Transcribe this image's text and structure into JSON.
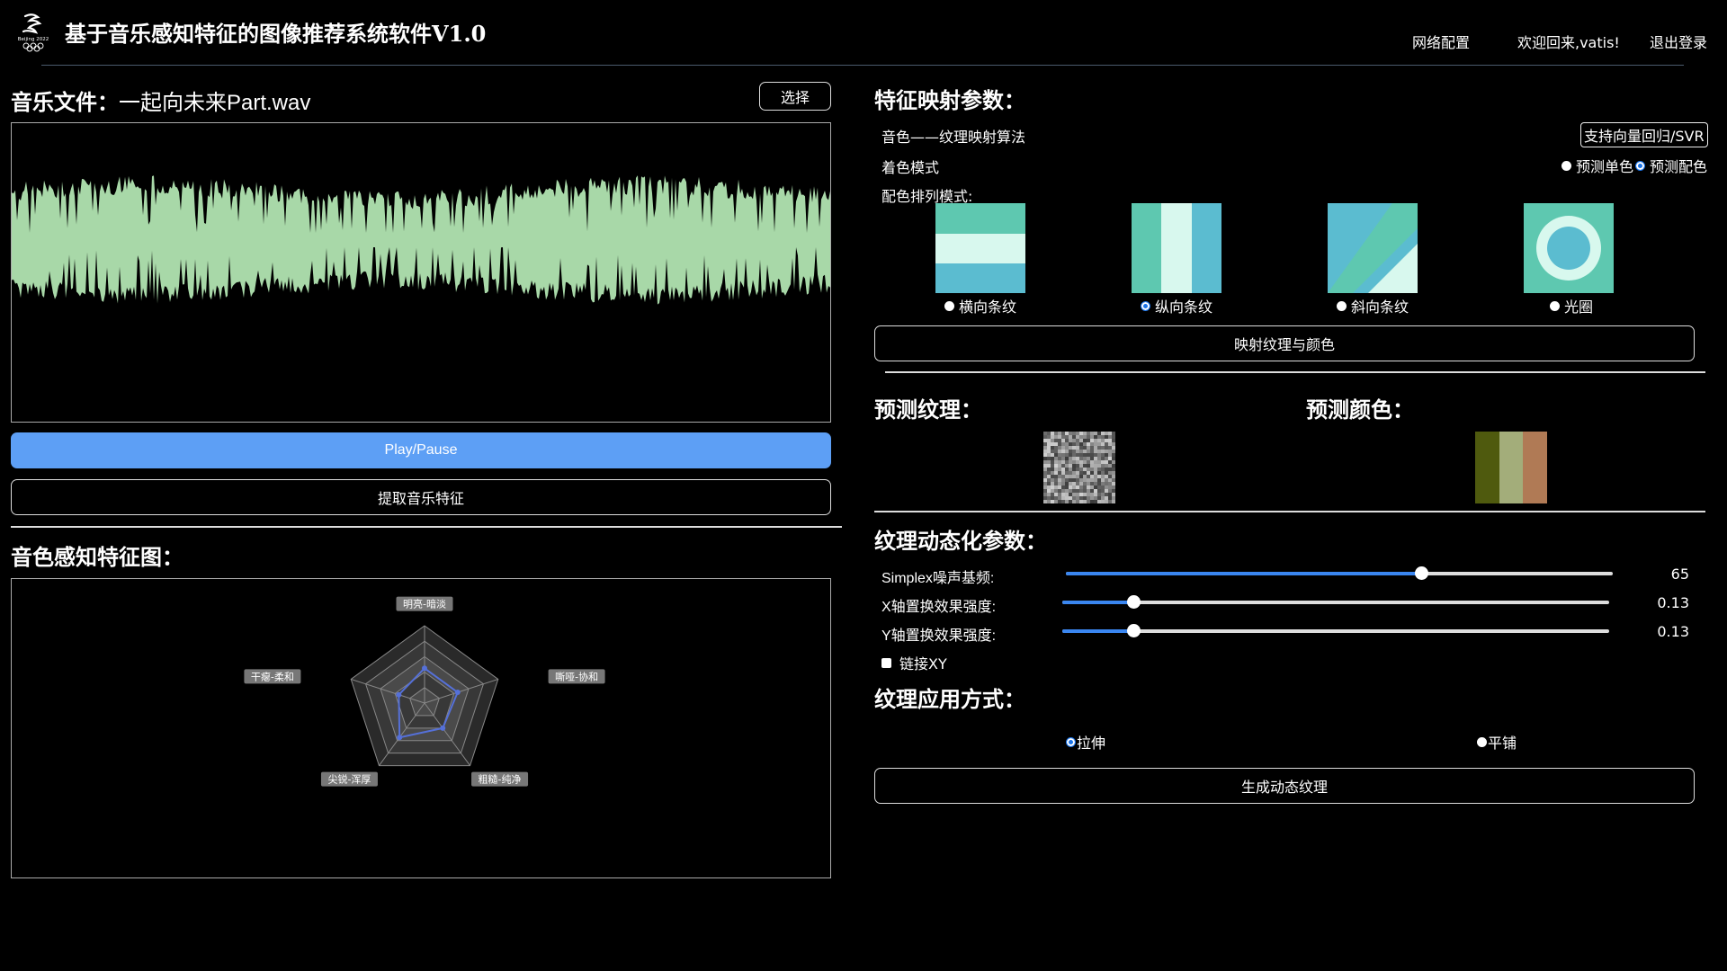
{
  "header": {
    "title": "基于音乐感知特征的图像推荐系统软件V1.0",
    "logo_text": "Beijing 2022",
    "nav": [
      "网络配置",
      "欢迎回来,vatis!",
      "退出登录"
    ]
  },
  "music": {
    "label": "音乐文件：",
    "file": "一起向未来Part.wav",
    "select_button": "选择",
    "play_button": "Play/Pause",
    "extract_button": "提取音乐特征",
    "waveform_color": "#a8d8a8"
  },
  "timbre": {
    "heading": "音色感知特征图：",
    "axes": [
      "明亮-暗淡",
      "嘶哑-协和",
      "粗糙-纯净",
      "尖锐-浑厚",
      "干瘪-柔和"
    ],
    "values": [
      0.45,
      0.45,
      0.4,
      0.55,
      0.35
    ],
    "series_color": "#5570d8"
  },
  "mapping": {
    "heading": "特征映射参数：",
    "algorithm_label": "音色——纹理映射算法",
    "algorithm_button": "支持向量回归/SVR",
    "color_mode_label": "着色模式",
    "color_modes": [
      {
        "label": "预测单色",
        "selected": false
      },
      {
        "label": "预测配色",
        "selected": true
      }
    ],
    "arrangement_label": "配色排列模式:",
    "arrangements": [
      {
        "label": "横向条纹",
        "selected": false
      },
      {
        "label": "纵向条纹",
        "selected": true
      },
      {
        "label": "斜向条纹",
        "selected": false
      },
      {
        "label": "光圈",
        "selected": false
      }
    ],
    "pattern_colors": [
      "#5ec8b0",
      "#5bbcd0",
      "#d8f8ee"
    ],
    "map_button": "映射纹理与颜色"
  },
  "prediction": {
    "texture_heading": "预测纹理：",
    "color_heading": "预测颜色：",
    "palette": [
      "#4f5a0e",
      "#a3ad7a",
      "#b07a55"
    ]
  },
  "dynamic": {
    "heading": "纹理动态化参数：",
    "sliders": [
      {
        "label": "Simplex噪声基频:",
        "value": "65",
        "fraction": 0.65
      },
      {
        "label": "X轴置换效果强度:",
        "value": "0.13",
        "fraction": 0.13
      },
      {
        "label": "Y轴置换效果强度:",
        "value": "0.13",
        "fraction": 0.13
      }
    ],
    "link_label": "链接XY"
  },
  "apply": {
    "heading": "纹理应用方式：",
    "modes": [
      {
        "label": "拉伸",
        "selected": true
      },
      {
        "label": "平铺",
        "selected": false
      }
    ],
    "generate_button": "生成动态纹理"
  }
}
